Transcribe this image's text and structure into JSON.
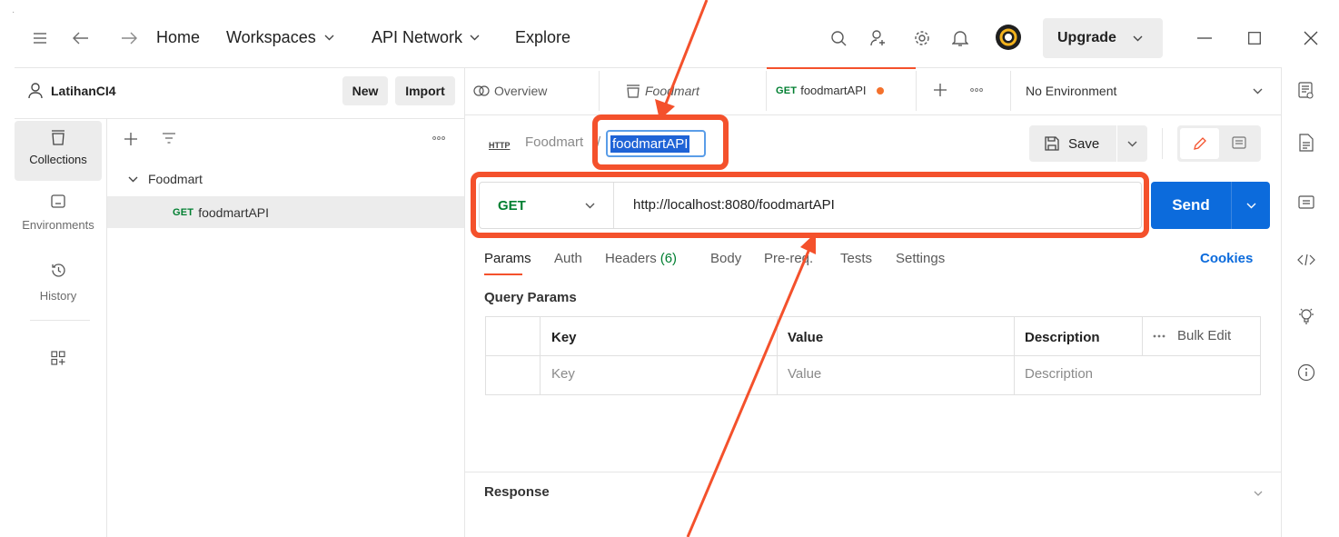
{
  "topbar": {
    "home": "Home",
    "workspaces": "Workspaces",
    "api_network": "API Network",
    "explore": "Explore",
    "upgrade": "Upgrade"
  },
  "workspace": {
    "name": "LatihanCI4",
    "new_label": "New",
    "import_label": "Import"
  },
  "sidebar": {
    "collections": "Collections",
    "environments": "Environments",
    "history": "History"
  },
  "tree": {
    "collection": "Foodmart",
    "request_method": "GET",
    "request_name": "foodmartAPI"
  },
  "tabs": {
    "overview": "Overview",
    "foodmart": "Foodmart",
    "active_method": "GET",
    "active_name": "foodmartAPI",
    "environment": "No Environment"
  },
  "request": {
    "breadcrumb_badge": "HTTP",
    "breadcrumb_parent": "Foodmart",
    "breadcrumb_sep": "/",
    "name": "foodmartAPI",
    "save_label": "Save",
    "method": "GET",
    "url": "http://localhost:8080/foodmartAPI",
    "send_label": "Send"
  },
  "subtabs": {
    "params": "Params",
    "auth": "Auth",
    "headers": "Headers",
    "headers_count": "(6)",
    "body": "Body",
    "prereq": "Pre-req.",
    "tests": "Tests",
    "settings": "Settings",
    "cookies": "Cookies"
  },
  "query": {
    "title": "Query Params",
    "headers": [
      "Key",
      "Value",
      "Description"
    ],
    "bulk_edit": "Bulk Edit",
    "placeholders": [
      "Key",
      "Value",
      "Description"
    ]
  },
  "response": {
    "title": "Response"
  },
  "colors": {
    "accent_orange": "#f4512c",
    "send_blue": "#0c6bdc",
    "get_green": "#007f31"
  }
}
